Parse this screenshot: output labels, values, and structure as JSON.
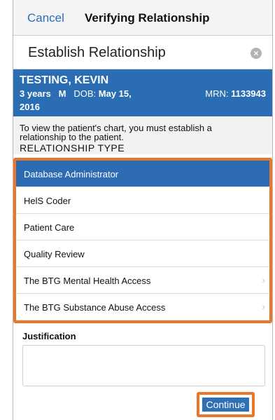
{
  "nav": {
    "cancel_label": "Cancel",
    "title": "Verifying Relationship"
  },
  "page": {
    "title": "Establish Relationship",
    "close_icon": "close-circle-icon"
  },
  "patient": {
    "name": "TESTING, KEVIN",
    "age": "3 years",
    "sex": "M",
    "dob_label": "DOB:",
    "dob_value": "May 15,",
    "dob_year": "2016",
    "mrn_label": "MRN:",
    "mrn_value": "1133943"
  },
  "message": {
    "text": "To view the patient's chart, you must establish a relationship to the patient.",
    "relationship_type_header": "RELATIONSHIP TYPE"
  },
  "relationship_types": [
    {
      "label": "Database Administrator",
      "selected": true,
      "chevron": false
    },
    {
      "label": "HelS Coder",
      "selected": false,
      "chevron": false
    },
    {
      "label": "Patient Care",
      "selected": false,
      "chevron": false
    },
    {
      "label": "Quality Review",
      "selected": false,
      "chevron": false
    },
    {
      "label": "The BTG Mental Health Access",
      "selected": false,
      "chevron": true
    },
    {
      "label": "The BTG Substance Abuse Access",
      "selected": false,
      "chevron": true
    }
  ],
  "justification": {
    "label": "Justification",
    "value": ""
  },
  "actions": {
    "continue_label": "Continue"
  },
  "colors": {
    "accent_blue": "#2a6db2",
    "highlight_orange": "#e8762b",
    "nav_link": "#2c6ebd"
  }
}
